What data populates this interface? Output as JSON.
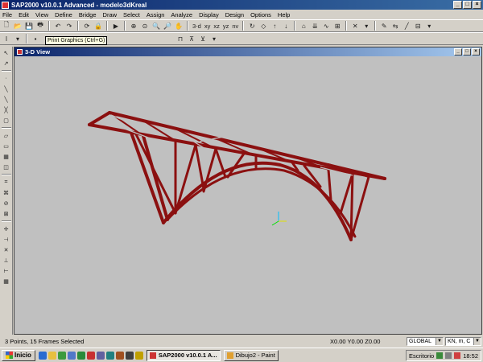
{
  "window": {
    "title": "SAP2000  v10.0.1  Advanced   - modelo3dKreal"
  },
  "menu": [
    "File",
    "Edit",
    "View",
    "Define",
    "Bridge",
    "Draw",
    "Select",
    "Assign",
    "Analyze",
    "Display",
    "Design",
    "Options",
    "Help"
  ],
  "toolbar": {
    "view_3d": "3-d",
    "view_xy": "xy",
    "view_xz": "xz",
    "view_yz": "yz",
    "nav_pan": "nv",
    "tooltip": "Print Graphics (Ctrl+G)"
  },
  "child_window": {
    "title": "3-D View"
  },
  "status": {
    "selection": "3 Points, 15 Frames Selected",
    "coords": "X0.00  Y0.00  Z0.00",
    "coord_system": "GLOBAL",
    "units": "KN, m, C"
  },
  "taskbar": {
    "start_label": "Inicio",
    "tasks": [
      {
        "label": "SAP2000  v10.0.1   A...",
        "active": true
      },
      {
        "label": "Dibujo2 - Paint",
        "active": false
      }
    ],
    "desk_label": "Escritorio",
    "clock": "18:52"
  },
  "colors": {
    "frame": "#8b1010",
    "frame_highlight": "#c0c0c0",
    "title_gradient_start": "#0a246a",
    "title_gradient_end": "#3a6ea5"
  }
}
